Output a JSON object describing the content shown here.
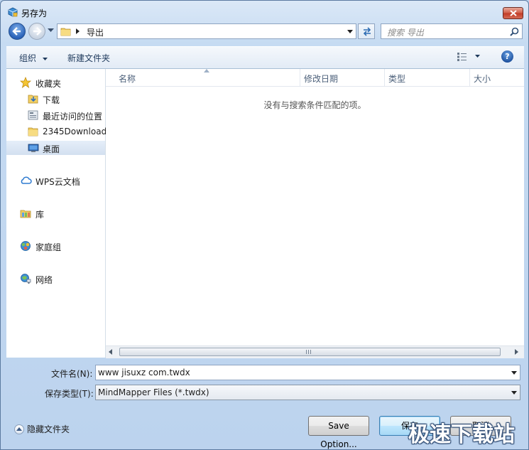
{
  "window": {
    "title": "另存为",
    "close_icon": "close-icon"
  },
  "address_bar": {
    "path": "导出"
  },
  "search": {
    "placeholder": "搜索 导出"
  },
  "toolbar": {
    "organize_label": "组织",
    "new_folder_label": "新建文件夹"
  },
  "navigation": {
    "favorites": [
      {
        "label": "收藏夹",
        "icon": "star-icon"
      },
      {
        "label": "下载",
        "icon": "folder-download-icon"
      },
      {
        "label": "最近访问的位置",
        "icon": "recent-places-icon"
      },
      {
        "label": "2345Download",
        "icon": "folder-icon"
      },
      {
        "label": "桌面",
        "icon": "desktop-icon",
        "selected": true
      }
    ],
    "wps_cloud": "WPS云文档",
    "libraries": "库",
    "homegroup": "家庭组",
    "network": "网络"
  },
  "file_list": {
    "columns": [
      "名称",
      "修改日期",
      "类型",
      "大小"
    ],
    "empty_message": "没有与搜索条件匹配的项。"
  },
  "form": {
    "filename_label": "文件名(N):",
    "filename_value": "www jisuxz com.twdx",
    "filetype_label": "保存类型(T):",
    "filetype_value": "MindMapper Files (*.twdx)"
  },
  "footer": {
    "hide_folders_label": "隐藏文件夹",
    "save_options_label": "Save Option...",
    "save_label": "保存",
    "cancel_label": "取消"
  },
  "watermark": "极速下载站"
}
